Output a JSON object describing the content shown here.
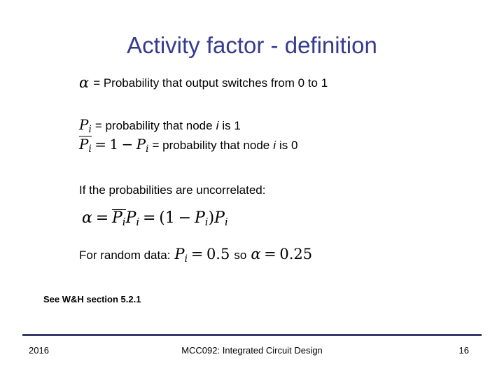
{
  "slide": {
    "title": "Activity factor - definition",
    "title_color": "#363b8c",
    "rule_color": "#363b6b",
    "text_color": "#000000"
  },
  "body": {
    "alpha_def": {
      "symbol": "α",
      "text": "= Probability that output switches from 0 to 1"
    },
    "p_def": {
      "p_symbol": "P",
      "subscript": "i",
      "line1_text": "= probability that node",
      "line1_italic": "i",
      "line1_tail": "is 1",
      "line2_equals": "=",
      "line2_one": "1",
      "line2_minus": "−",
      "line2_text": "= probability that node",
      "line2_italic": "i",
      "line2_tail": "is 0"
    },
    "uncorrelated_text": "If the probabilities are uncorrelated:",
    "main_equation": {
      "alpha": "α",
      "eq1": "=",
      "pbar": "P",
      "p": "P",
      "sub": "i",
      "eq2": "=",
      "open_paren": "(",
      "one": "1",
      "minus": "−",
      "close_paren": ")"
    },
    "random_data": {
      "label": "For random data:",
      "p_symbol": "P",
      "sub": "i",
      "eq1": "=",
      "p_value": "0.5",
      "so": "so",
      "alpha": "α",
      "eq2": "=",
      "alpha_value": "0.25"
    }
  },
  "reference": {
    "note": "See W&H section 5.2.1"
  },
  "footer": {
    "date": "2016",
    "course": "MCC092: Integrated Circuit Design",
    "page_number": "16"
  }
}
